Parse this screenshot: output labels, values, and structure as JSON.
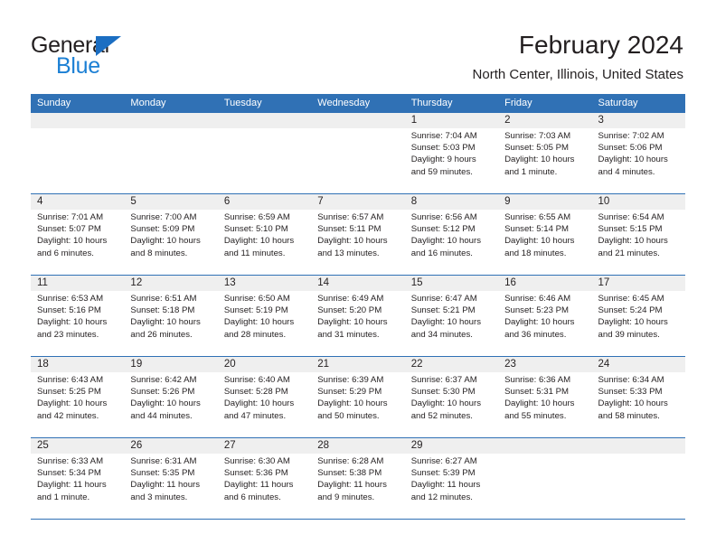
{
  "brand": {
    "line1": "General",
    "line2": "Blue",
    "triangle_color": "#1b6ec2"
  },
  "header": {
    "title": "February 2024",
    "subtitle": "North Center, Illinois, United States"
  },
  "theme": {
    "header_blue": "#3071b5",
    "day_band_gray": "#efefef",
    "text": "#231f20"
  },
  "weekday_headers": [
    "Sunday",
    "Monday",
    "Tuesday",
    "Wednesday",
    "Thursday",
    "Friday",
    "Saturday"
  ],
  "weeks": [
    [
      {
        "day": "",
        "lines": []
      },
      {
        "day": "",
        "lines": []
      },
      {
        "day": "",
        "lines": []
      },
      {
        "day": "",
        "lines": []
      },
      {
        "day": "1",
        "lines": [
          "Sunrise: 7:04 AM",
          "Sunset: 5:03 PM",
          "Daylight: 9 hours",
          "and 59 minutes."
        ]
      },
      {
        "day": "2",
        "lines": [
          "Sunrise: 7:03 AM",
          "Sunset: 5:05 PM",
          "Daylight: 10 hours",
          "and 1 minute."
        ]
      },
      {
        "day": "3",
        "lines": [
          "Sunrise: 7:02 AM",
          "Sunset: 5:06 PM",
          "Daylight: 10 hours",
          "and 4 minutes."
        ]
      }
    ],
    [
      {
        "day": "4",
        "lines": [
          "Sunrise: 7:01 AM",
          "Sunset: 5:07 PM",
          "Daylight: 10 hours",
          "and 6 minutes."
        ]
      },
      {
        "day": "5",
        "lines": [
          "Sunrise: 7:00 AM",
          "Sunset: 5:09 PM",
          "Daylight: 10 hours",
          "and 8 minutes."
        ]
      },
      {
        "day": "6",
        "lines": [
          "Sunrise: 6:59 AM",
          "Sunset: 5:10 PM",
          "Daylight: 10 hours",
          "and 11 minutes."
        ]
      },
      {
        "day": "7",
        "lines": [
          "Sunrise: 6:57 AM",
          "Sunset: 5:11 PM",
          "Daylight: 10 hours",
          "and 13 minutes."
        ]
      },
      {
        "day": "8",
        "lines": [
          "Sunrise: 6:56 AM",
          "Sunset: 5:12 PM",
          "Daylight: 10 hours",
          "and 16 minutes."
        ]
      },
      {
        "day": "9",
        "lines": [
          "Sunrise: 6:55 AM",
          "Sunset: 5:14 PM",
          "Daylight: 10 hours",
          "and 18 minutes."
        ]
      },
      {
        "day": "10",
        "lines": [
          "Sunrise: 6:54 AM",
          "Sunset: 5:15 PM",
          "Daylight: 10 hours",
          "and 21 minutes."
        ]
      }
    ],
    [
      {
        "day": "11",
        "lines": [
          "Sunrise: 6:53 AM",
          "Sunset: 5:16 PM",
          "Daylight: 10 hours",
          "and 23 minutes."
        ]
      },
      {
        "day": "12",
        "lines": [
          "Sunrise: 6:51 AM",
          "Sunset: 5:18 PM",
          "Daylight: 10 hours",
          "and 26 minutes."
        ]
      },
      {
        "day": "13",
        "lines": [
          "Sunrise: 6:50 AM",
          "Sunset: 5:19 PM",
          "Daylight: 10 hours",
          "and 28 minutes."
        ]
      },
      {
        "day": "14",
        "lines": [
          "Sunrise: 6:49 AM",
          "Sunset: 5:20 PM",
          "Daylight: 10 hours",
          "and 31 minutes."
        ]
      },
      {
        "day": "15",
        "lines": [
          "Sunrise: 6:47 AM",
          "Sunset: 5:21 PM",
          "Daylight: 10 hours",
          "and 34 minutes."
        ]
      },
      {
        "day": "16",
        "lines": [
          "Sunrise: 6:46 AM",
          "Sunset: 5:23 PM",
          "Daylight: 10 hours",
          "and 36 minutes."
        ]
      },
      {
        "day": "17",
        "lines": [
          "Sunrise: 6:45 AM",
          "Sunset: 5:24 PM",
          "Daylight: 10 hours",
          "and 39 minutes."
        ]
      }
    ],
    [
      {
        "day": "18",
        "lines": [
          "Sunrise: 6:43 AM",
          "Sunset: 5:25 PM",
          "Daylight: 10 hours",
          "and 42 minutes."
        ]
      },
      {
        "day": "19",
        "lines": [
          "Sunrise: 6:42 AM",
          "Sunset: 5:26 PM",
          "Daylight: 10 hours",
          "and 44 minutes."
        ]
      },
      {
        "day": "20",
        "lines": [
          "Sunrise: 6:40 AM",
          "Sunset: 5:28 PM",
          "Daylight: 10 hours",
          "and 47 minutes."
        ]
      },
      {
        "day": "21",
        "lines": [
          "Sunrise: 6:39 AM",
          "Sunset: 5:29 PM",
          "Daylight: 10 hours",
          "and 50 minutes."
        ]
      },
      {
        "day": "22",
        "lines": [
          "Sunrise: 6:37 AM",
          "Sunset: 5:30 PM",
          "Daylight: 10 hours",
          "and 52 minutes."
        ]
      },
      {
        "day": "23",
        "lines": [
          "Sunrise: 6:36 AM",
          "Sunset: 5:31 PM",
          "Daylight: 10 hours",
          "and 55 minutes."
        ]
      },
      {
        "day": "24",
        "lines": [
          "Sunrise: 6:34 AM",
          "Sunset: 5:33 PM",
          "Daylight: 10 hours",
          "and 58 minutes."
        ]
      }
    ],
    [
      {
        "day": "25",
        "lines": [
          "Sunrise: 6:33 AM",
          "Sunset: 5:34 PM",
          "Daylight: 11 hours",
          "and 1 minute."
        ]
      },
      {
        "day": "26",
        "lines": [
          "Sunrise: 6:31 AM",
          "Sunset: 5:35 PM",
          "Daylight: 11 hours",
          "and 3 minutes."
        ]
      },
      {
        "day": "27",
        "lines": [
          "Sunrise: 6:30 AM",
          "Sunset: 5:36 PM",
          "Daylight: 11 hours",
          "and 6 minutes."
        ]
      },
      {
        "day": "28",
        "lines": [
          "Sunrise: 6:28 AM",
          "Sunset: 5:38 PM",
          "Daylight: 11 hours",
          "and 9 minutes."
        ]
      },
      {
        "day": "29",
        "lines": [
          "Sunrise: 6:27 AM",
          "Sunset: 5:39 PM",
          "Daylight: 11 hours",
          "and 12 minutes."
        ]
      },
      {
        "day": "",
        "lines": []
      },
      {
        "day": "",
        "lines": []
      }
    ]
  ]
}
